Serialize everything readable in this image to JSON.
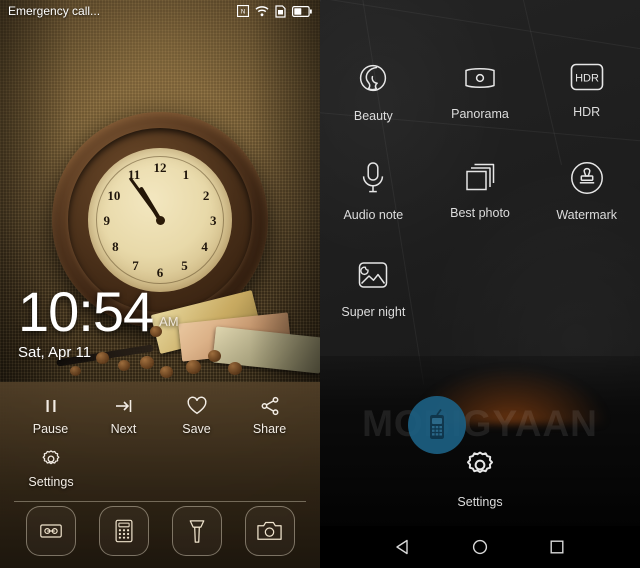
{
  "lockscreen": {
    "status": {
      "text": "Emergency call...",
      "icons": [
        {
          "name": "nfc-icon",
          "label": "NFC"
        },
        {
          "name": "wifi-icon",
          "label": "Wi-Fi"
        },
        {
          "name": "sim-card-icon",
          "label": "SIM"
        },
        {
          "name": "battery-icon",
          "label": "Battery"
        }
      ]
    },
    "clock": {
      "time": "10:54",
      "ampm": "AM",
      "date": "Sat, Apr 11"
    },
    "wallpaper_controls": [
      {
        "label": "Pause",
        "icon": "pause-icon"
      },
      {
        "label": "Next",
        "icon": "next-icon"
      },
      {
        "label": "Save",
        "icon": "heart-icon"
      },
      {
        "label": "Share",
        "icon": "share-icon"
      },
      {
        "label": "Settings",
        "icon": "gear-icon"
      }
    ],
    "shortcuts": [
      {
        "name": "voice-recorder-shortcut",
        "icon": "tape-recorder-icon"
      },
      {
        "name": "calculator-shortcut",
        "icon": "calculator-icon"
      },
      {
        "name": "flashlight-shortcut",
        "icon": "flashlight-icon"
      },
      {
        "name": "camera-shortcut",
        "icon": "camera-icon"
      }
    ]
  },
  "camera": {
    "modes": [
      {
        "label": "Beauty",
        "icon": "beauty-face-icon"
      },
      {
        "label": "Panorama",
        "icon": "panorama-icon"
      },
      {
        "label": "HDR",
        "icon": "hdr-icon",
        "glyph": "HDR"
      },
      {
        "label": "Audio note",
        "icon": "microphone-icon"
      },
      {
        "label": "Best photo",
        "icon": "stacked-photos-icon"
      },
      {
        "label": "Watermark",
        "icon": "stamp-icon"
      },
      {
        "label": "Super night",
        "icon": "night-photo-icon"
      }
    ],
    "settings": {
      "label": "Settings",
      "icon": "gear-icon"
    }
  },
  "watermark": {
    "text": "MOBIGYAAN",
    "logo_color": "#1c5f82"
  },
  "navbar": [
    {
      "name": "back-button",
      "icon": "back-triangle-icon"
    },
    {
      "name": "home-button",
      "icon": "home-circle-icon"
    },
    {
      "name": "recents-button",
      "icon": "recents-square-icon"
    }
  ],
  "colors": {
    "lock_accent": "#f2ece4",
    "camera_label": "#dcdcdc",
    "navbar_bg": "#000000"
  }
}
